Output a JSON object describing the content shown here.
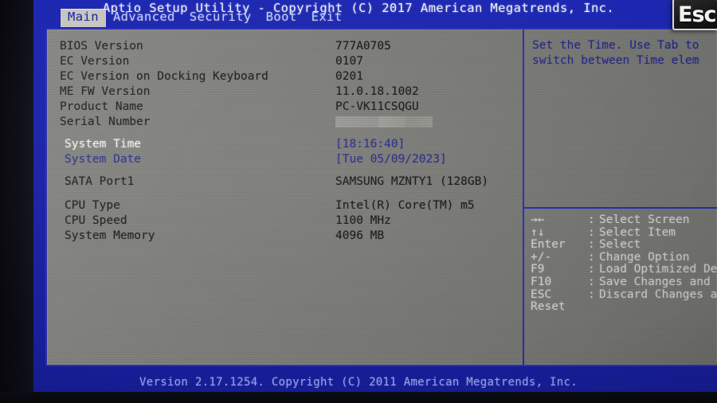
{
  "titlebar": {
    "text": "Aptio Setup Utility - Copyright (C) 2017 American Megatrends, Inc."
  },
  "menu": {
    "tabs": [
      {
        "label": "Main",
        "active": true
      },
      {
        "label": "Advanced",
        "active": false
      },
      {
        "label": "Security",
        "active": false
      },
      {
        "label": "Boot",
        "active": false
      },
      {
        "label": "Exit",
        "active": false
      }
    ]
  },
  "main": {
    "info_rows": [
      {
        "label": "BIOS Version",
        "value": "777A0705"
      },
      {
        "label": "EC Version",
        "value": "0107"
      },
      {
        "label": "EC Version on Docking Keyboard",
        "value": "0201"
      },
      {
        "label": "ME FW Version",
        "value": "11.0.18.1002"
      },
      {
        "label": "Product Name",
        "value": "PC-VK11CSQGU"
      },
      {
        "label": "Serial Number",
        "value": ""
      }
    ],
    "time_rows": [
      {
        "label": "System Time",
        "value": "[18:16:40]",
        "selected": true
      },
      {
        "label": "System Date",
        "value": "[Tue 05/09/2023]",
        "selected": false
      }
    ],
    "storage_rows": [
      {
        "label": "SATA Port1",
        "value": "SAMSUNG MZNTY1 (128GB)"
      }
    ],
    "cpu_rows": [
      {
        "label": "CPU Type",
        "value": "Intel(R) Core(TM) m5"
      },
      {
        "label": "CPU Speed",
        "value": "1100 MHz"
      },
      {
        "label": "System Memory",
        "value": "4096 MB"
      }
    ]
  },
  "help": {
    "line1": "Set the Time. Use Tab to",
    "line2": "switch between Time elem"
  },
  "keys": [
    {
      "key": "→←",
      "desc": "Select Screen"
    },
    {
      "key": "↑↓",
      "desc": "Select Item"
    },
    {
      "key": "Enter",
      "desc": "Select"
    },
    {
      "key": "+/-",
      "desc": "Change Option"
    },
    {
      "key": "F9",
      "desc": "Load Optimized De"
    },
    {
      "key": "F10",
      "desc": "Save Changes and"
    },
    {
      "key": "ESC",
      "desc": "Discard Changes a"
    },
    {
      "key": "Reset",
      "desc": ""
    }
  ],
  "footer": {
    "text": "Version 2.17.1254. Copyright (C) 2011 American Megatrends, Inc."
  },
  "overlay": {
    "keycap_label": "Esc"
  },
  "colors": {
    "screen_blue": "#1d28b4",
    "panel_gray": "#7b7b77",
    "frame_blue": "#2a2fb8",
    "label_dark": "#16161c",
    "label_blue": "#262a8e",
    "label_white": "#edeeef"
  }
}
